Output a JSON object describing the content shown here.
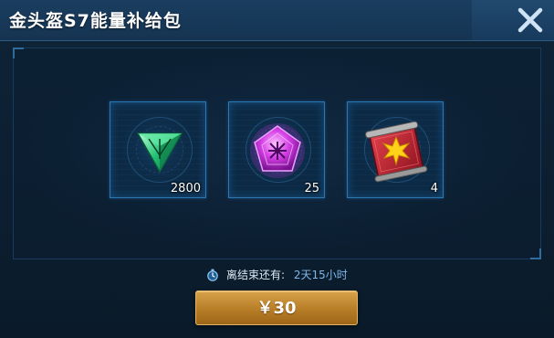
{
  "dialog": {
    "title": "金头盔S7能量补给包",
    "close_icon": "close-icon"
  },
  "items": [
    {
      "icon": "green-triangle-gem-icon",
      "count": "2800"
    },
    {
      "icon": "purple-pentagon-crystal-icon",
      "count": "25"
    },
    {
      "icon": "red-scroll-card-icon",
      "count": "4"
    }
  ],
  "timer": {
    "icon": "stopwatch-icon",
    "label": "离结束还有:",
    "value": "2天15小时"
  },
  "purchase": {
    "price_label": "￥30"
  },
  "colors": {
    "background": "#0c1f31",
    "header": "#153452",
    "slot_border": "#2b78b5",
    "button": "#c58d33",
    "timer_value": "#7fb8e8"
  }
}
